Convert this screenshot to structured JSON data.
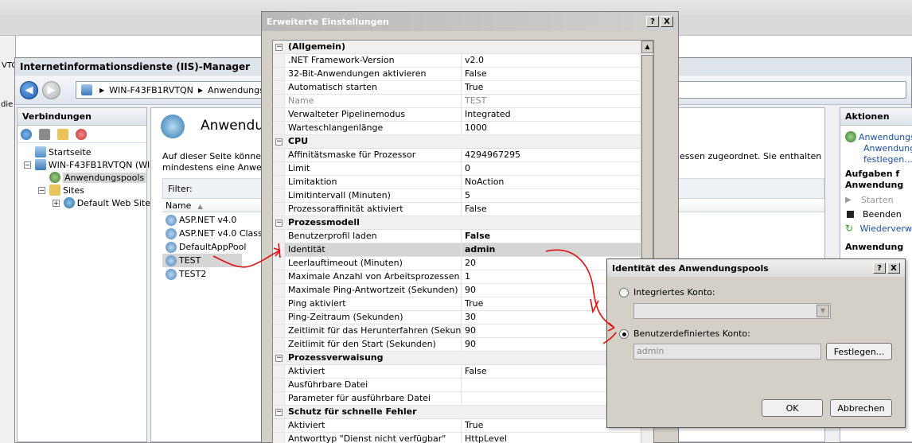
{
  "iis": {
    "title": "Internetinformationsdienste (IIS)-Manager",
    "address": {
      "server": "WIN-F43FB1RVTQN",
      "section": "Anwendungsp"
    },
    "connections": {
      "header": "Verbindungen",
      "tree": [
        {
          "label": "Startseite"
        },
        {
          "label": "WIN-F43FB1RVTQN (WIN"
        },
        {
          "label": "Anwendungspools"
        },
        {
          "label": "Sites"
        },
        {
          "label": "Default Web Site"
        }
      ]
    },
    "main": {
      "title": "Anwendun",
      "desc_line1": "Auf dieser Seite können S",
      "desc_line2": "mindestens eine Anwendu",
      "desc_right": "essen zugeordnet. Sie enthalten",
      "filter_label": "Filter:",
      "column_name": "Name",
      "pools": [
        "ASP.NET v4.0",
        "ASP.NET v4.0 Classic",
        "DefaultAppPool",
        "TEST",
        "TEST2"
      ]
    },
    "actions": {
      "header": "Aktionen",
      "items": [
        "Anwendungs",
        "Anwendungs",
        "festlegen...",
        "Aufgaben f",
        "Anwendung",
        "Starten",
        "Beenden",
        "Wiederverw",
        "Anwendung"
      ]
    },
    "left_fragments": {
      "top": "VTC",
      "side": "die"
    }
  },
  "advanced": {
    "title": "Erweiterte Einstellungen",
    "help": "?",
    "close": "X",
    "rows": [
      {
        "cat": "(Allgemein)"
      },
      {
        "k": ".NET Framework-Version",
        "v": "v2.0"
      },
      {
        "k": "32-Bit-Anwendungen aktivieren",
        "v": "False"
      },
      {
        "k": "Automatisch starten",
        "v": "True"
      },
      {
        "k": "Name",
        "v": "TEST",
        "dim": true
      },
      {
        "k": "Verwalteter Pipelinemodus",
        "v": "Integrated"
      },
      {
        "k": "Warteschlangenlänge",
        "v": "1000"
      },
      {
        "cat": "CPU"
      },
      {
        "k": "Affinitätsmaske für Prozessor",
        "v": "4294967295"
      },
      {
        "k": "Limit",
        "v": "0"
      },
      {
        "k": "Limitaktion",
        "v": "NoAction"
      },
      {
        "k": "Limitintervall (Minuten)",
        "v": "5"
      },
      {
        "k": "Prozessoraffinität aktiviert",
        "v": "False"
      },
      {
        "cat": "Prozessmodell"
      },
      {
        "k": "Benutzerprofil laden",
        "v": "False",
        "bold": true
      },
      {
        "k": "Identität",
        "v": "admin",
        "bold": true,
        "sel": true
      },
      {
        "k": "Leerlauftimeout (Minuten)",
        "v": "20"
      },
      {
        "k": "Maximale Anzahl von Arbeitsprozessen",
        "v": "1"
      },
      {
        "k": "Maximale Ping-Antwortzeit (Sekunden)",
        "v": "90"
      },
      {
        "k": "Ping aktiviert",
        "v": "True"
      },
      {
        "k": "Ping-Zeitraum (Sekunden)",
        "v": "30"
      },
      {
        "k": "Zeitlimit für das Herunterfahren (Sekunden)",
        "v": "90"
      },
      {
        "k": "Zeitlimit für den Start (Sekunden)",
        "v": "90"
      },
      {
        "cat": "Prozessverwaisung"
      },
      {
        "k": "Aktiviert",
        "v": "False"
      },
      {
        "k": "Ausführbare Datei",
        "v": ""
      },
      {
        "k": "Parameter für ausführbare Datei",
        "v": ""
      },
      {
        "cat": "Schutz für schnelle Fehler"
      },
      {
        "k": "Aktiviert",
        "v": "True"
      },
      {
        "k": "Antworttyp \"Dienst nicht verfügbar\"",
        "v": "HttpLevel"
      }
    ]
  },
  "identity": {
    "title": "Identität des Anwendungspools",
    "help": "?",
    "close": "X",
    "builtin_label": "Integriertes Konto:",
    "custom_label": "Benutzerdefiniertes Konto:",
    "custom_value": "admin",
    "set_button": "Festlegen...",
    "ok": "OK",
    "cancel": "Abbrechen"
  }
}
